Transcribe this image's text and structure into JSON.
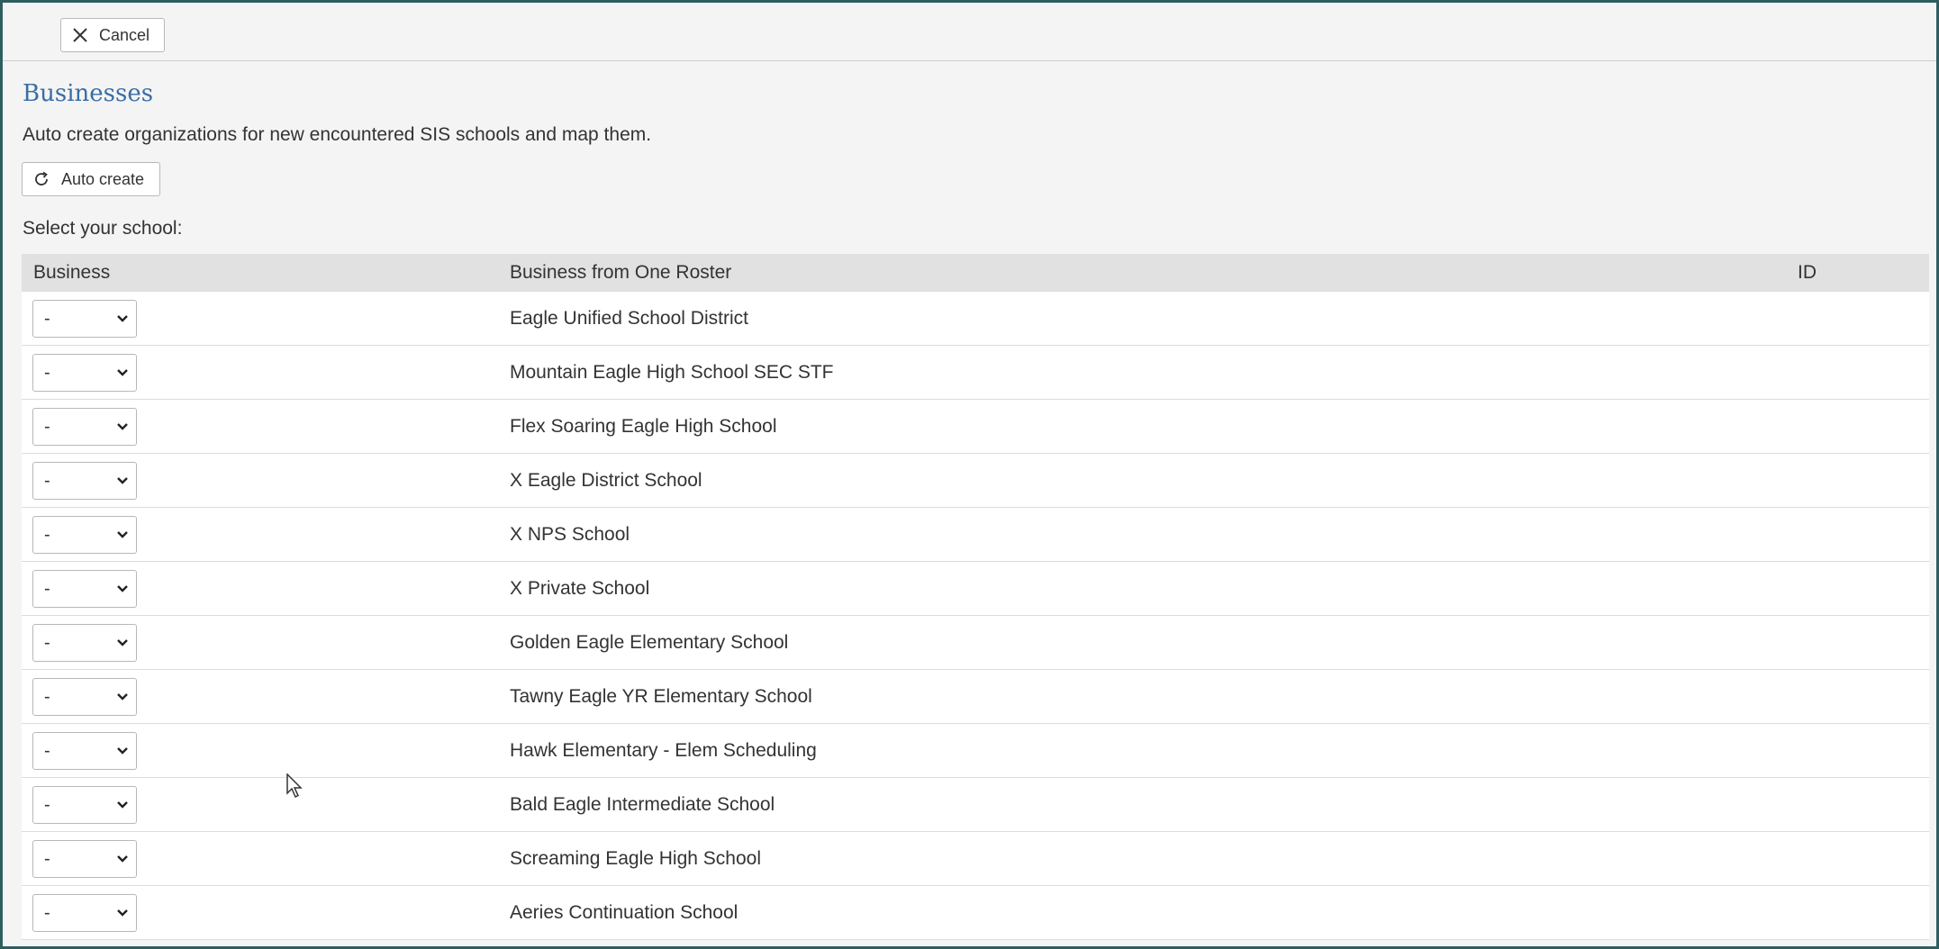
{
  "toolbar": {
    "cancel_label": "Cancel"
  },
  "section": {
    "title": "Businesses",
    "description": "Auto create organizations for new encountered SIS schools and map them.",
    "auto_create_label": "Auto create",
    "select_label": "Select your school:"
  },
  "table": {
    "headers": {
      "business": "Business",
      "roster": "Business from One Roster",
      "id": "ID"
    },
    "rows": [
      {
        "select_value": "-",
        "name": "Eagle Unified School District",
        "id": ""
      },
      {
        "select_value": "-",
        "name": "Mountain Eagle High School SEC STF",
        "id": ""
      },
      {
        "select_value": "-",
        "name": "Flex Soaring Eagle High School",
        "id": ""
      },
      {
        "select_value": "-",
        "name": "X Eagle District School",
        "id": ""
      },
      {
        "select_value": "-",
        "name": "X NPS School",
        "id": ""
      },
      {
        "select_value": "-",
        "name": "X Private School",
        "id": ""
      },
      {
        "select_value": "-",
        "name": "Golden Eagle Elementary School",
        "id": ""
      },
      {
        "select_value": "-",
        "name": "Tawny Eagle YR Elementary School",
        "id": ""
      },
      {
        "select_value": "-",
        "name": "Hawk Elementary - Elem Scheduling",
        "id": ""
      },
      {
        "select_value": "-",
        "name": "Bald Eagle Intermediate School",
        "id": ""
      },
      {
        "select_value": "-",
        "name": "Screaming Eagle High School",
        "id": ""
      },
      {
        "select_value": "-",
        "name": "Aeries Continuation School",
        "id": ""
      }
    ]
  },
  "icons": {
    "cancel": "close-icon",
    "auto_create": "refresh-icon",
    "select": "chevron-down-icon",
    "pointer": "mouse-cursor-icon"
  },
  "colors": {
    "title": "#3a6ea5",
    "frame_border": "#2e5d60",
    "header_bg": "#e1e1e2"
  }
}
